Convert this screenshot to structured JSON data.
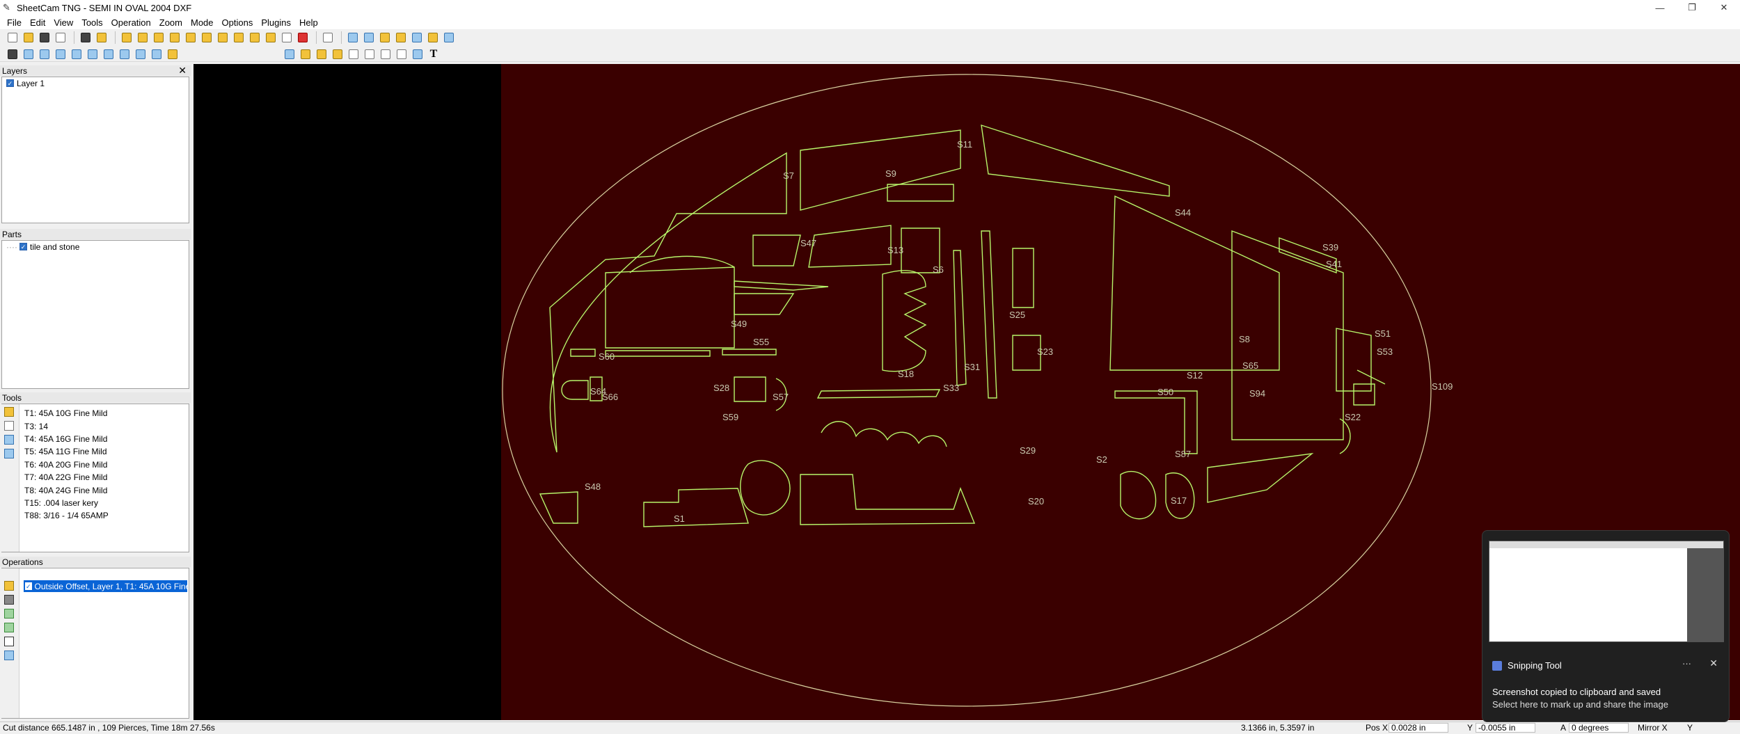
{
  "window": {
    "title": "SheetCam TNG - SEMI IN OVAL 2004 DXF",
    "minimize_glyph": "—",
    "maximize_glyph": "❐",
    "close_glyph": "✕"
  },
  "menu": [
    "File",
    "Edit",
    "View",
    "Tools",
    "Operation",
    "Zoom",
    "Mode",
    "Options",
    "Plugins",
    "Help"
  ],
  "panels": {
    "layers": {
      "title": "Layers",
      "items": [
        {
          "label": "Layer 1",
          "checked": true
        }
      ]
    },
    "parts": {
      "title": "Parts",
      "items": [
        {
          "label": "tile and stone",
          "checked": true
        }
      ]
    },
    "tools": {
      "title": "Tools",
      "items": [
        "T1: 45A 10G Fine Mild",
        "T3: 14",
        "T4: 45A 16G Fine Mild",
        "T5: 45A 11G Fine Mild",
        "T6: 40A 20G Fine Mild",
        "T7: 40A 22G Fine Mild",
        "T8: 40A 24G Fine Mild",
        "T15: .004 laser kery",
        "T88: 3/16 - 1/4 65AMP"
      ]
    },
    "operations": {
      "title": "Operations",
      "items": [
        {
          "label": "Outside Offset, Layer 1, T1: 45A 10G Fine ...",
          "checked": true,
          "selected": true
        }
      ]
    }
  },
  "drawing": {
    "background": "#3a0000",
    "line_color": "#b7f56a",
    "oval_color": "#d9d2a0",
    "part_labels": [
      "S11",
      "S7",
      "S9",
      "S44",
      "S39",
      "S47",
      "S13",
      "S6",
      "S41",
      "S49",
      "S25",
      "S55",
      "S23",
      "S31",
      "S51",
      "S53",
      "S18",
      "S33",
      "S60",
      "S64",
      "S66",
      "S28",
      "S57",
      "S109",
      "S59",
      "S22",
      "S2",
      "S29",
      "S87",
      "S48",
      "S20",
      "S17",
      "S1",
      "S12",
      "S50",
      "S94",
      "S65",
      "S8"
    ]
  },
  "status": {
    "left": "Cut distance 665.1487 in , 109 Pierces, Time 18m 27.56s",
    "coords": "3.1366 in, 5.3597 in",
    "pos_x_label": "Pos X",
    "pos_x": "0.0028 in",
    "pos_y_label": "Y",
    "pos_y": "-0.0055 in",
    "angle_label": "A",
    "angle": "0 degrees",
    "mirror": "Mirror X",
    "mirror_y": "Y"
  },
  "toast": {
    "app": "Snipping Tool",
    "more": "···",
    "close": "✕",
    "message": "Screenshot copied to clipboard and saved",
    "submessage": "Select here to mark up and share the image"
  }
}
